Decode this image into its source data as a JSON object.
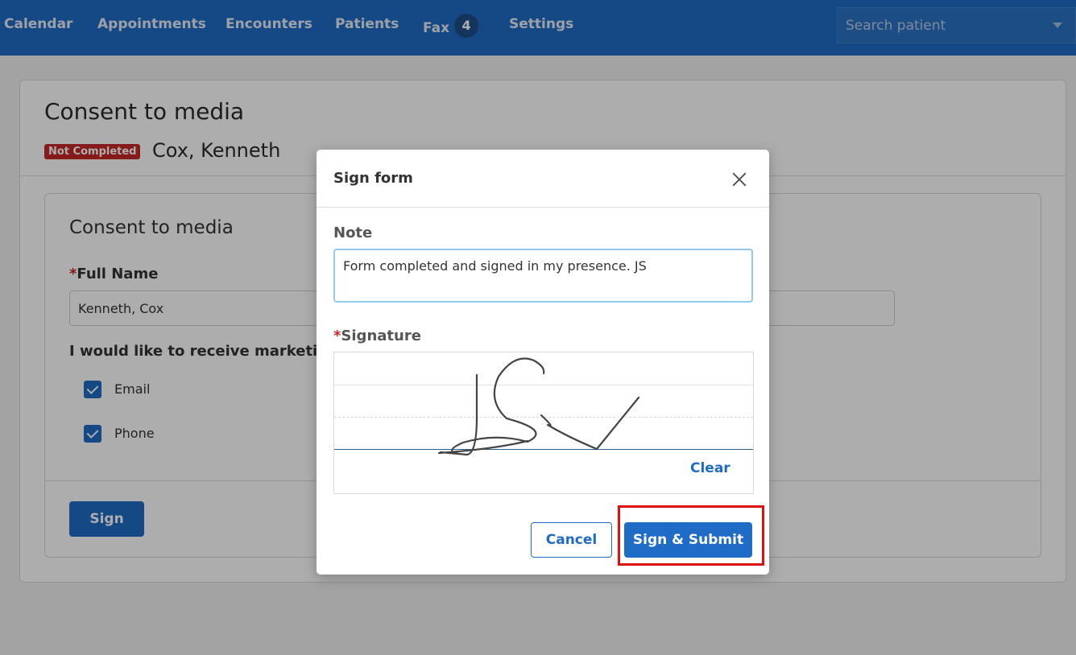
{
  "nav": {
    "items": [
      {
        "label": "Calendar"
      },
      {
        "label": "Appointments"
      },
      {
        "label": "Encounters"
      },
      {
        "label": "Patients"
      },
      {
        "label": "Fax",
        "badge": "4"
      },
      {
        "label": "Settings"
      }
    ],
    "search_placeholder": "Search patient"
  },
  "page": {
    "title": "Consent to media",
    "status": "Not Completed",
    "patient_name": "Cox, Kenneth"
  },
  "form": {
    "title": "Consent to media",
    "full_name_label": "Full Name",
    "full_name_value": "Kenneth, Cox",
    "marketing_label": "I would like to receive marketing",
    "options": [
      {
        "label": "Email",
        "checked": true
      },
      {
        "label": "Phone",
        "checked": true
      }
    ],
    "sign_label": "Sign"
  },
  "modal": {
    "title": "Sign form",
    "note_label": "Note",
    "note_value": "Form completed and signed in my presence. JS",
    "signature_label": "Signature",
    "clear_label": "Clear",
    "cancel_label": "Cancel",
    "submit_label": "Sign & Submit"
  },
  "colors": {
    "primary": "#1f6cc6",
    "required": "#c62828",
    "highlight": "#e01010"
  }
}
